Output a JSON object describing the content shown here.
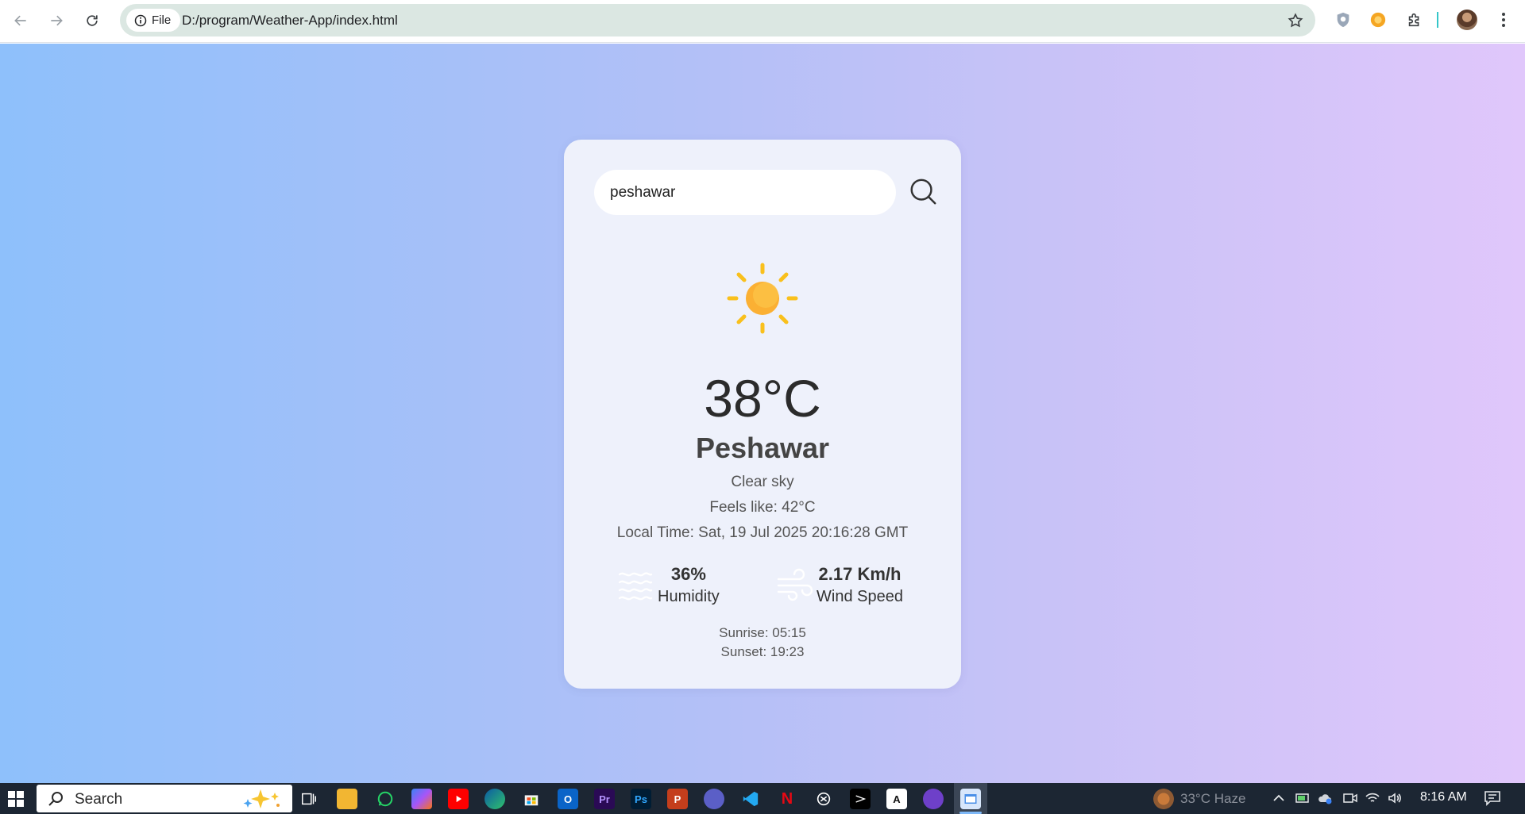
{
  "browser": {
    "site_chip_label": "File",
    "url": "D:/program/Weather-App/index.html"
  },
  "weather": {
    "search_value": "peshawar",
    "icon": "sun-icon",
    "temperature": "38°C",
    "city": "Peshawar",
    "description": "Clear sky",
    "feels_like": "Feels like: 42°C",
    "local_time": "Local Time: Sat, 19 Jul 2025 20:16:28 GMT",
    "humidity_value": "36%",
    "humidity_label": "Humidity",
    "wind_value": "2.17 Km/h",
    "wind_label": "Wind Speed",
    "sunrise": "Sunrise: 05:15",
    "sunset": "Sunset: 19:23"
  },
  "taskbar": {
    "search_label": "Search",
    "weather_text": "33°C  Haze",
    "clock": "8:16 AM",
    "apps": [
      "task-view",
      "file-explorer",
      "whatsapp",
      "copilot",
      "youtube",
      "edge",
      "microsoft-store",
      "outlook",
      "premiere-pro",
      "photoshop",
      "powerpoint",
      "teams",
      "vs-code",
      "netflix",
      "chatgpt",
      "capcut",
      "claude",
      "github-desktop",
      "weather-app-active"
    ]
  },
  "colors": {
    "page_gradient_start": "#8ec0fb",
    "page_gradient_end": "#e0c7fb",
    "card_background": "#eef1fb",
    "sun": "#f9c01c"
  }
}
